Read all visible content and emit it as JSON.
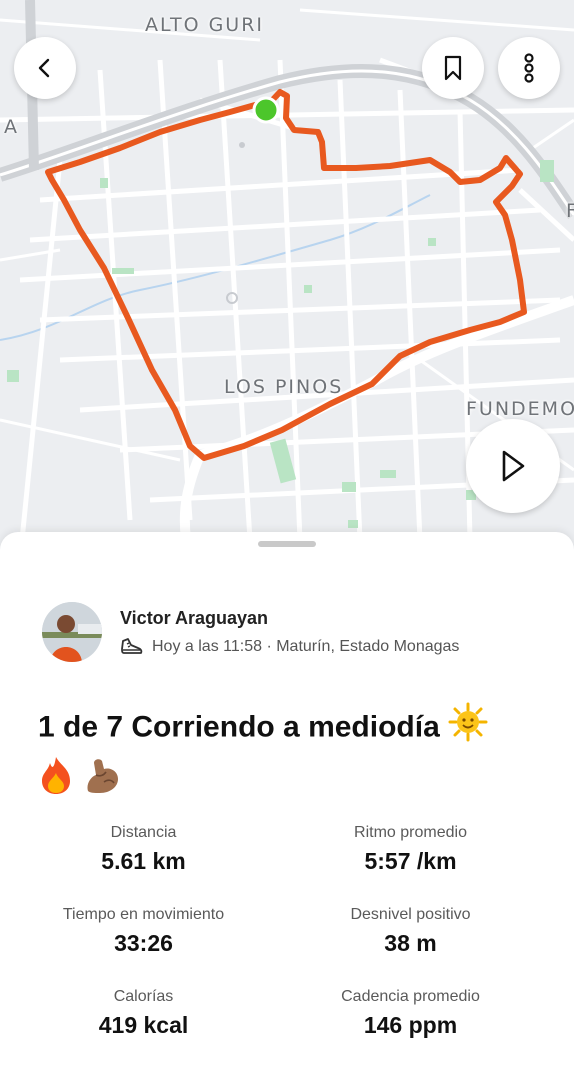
{
  "map": {
    "labels": {
      "alto_guri": "ALTO GURI",
      "los_pinos": "LOS PINOS",
      "fundemo": "FUNDEMO",
      "edge_left": "A",
      "edge_right": "F"
    },
    "colors": {
      "route": "#e8591f",
      "start_marker": "#4cc62b",
      "background": "#eceef1",
      "road": "#ffffff",
      "highway": "#cfd2d6",
      "park": "#b9e4c4",
      "water": "#b8d4ef"
    }
  },
  "toolbar": {
    "back_icon": "chevron-left-icon",
    "bookmark_icon": "bookmark-icon",
    "more_icon": "more-vertical-icon",
    "play_icon": "play-icon"
  },
  "athlete": {
    "name": "Victor Araguayan",
    "meta": "Hoy a las 11:58 · Maturín, Estado Monagas",
    "activity_icon": "running-shoe-icon"
  },
  "activity": {
    "title": "1 de 7 Corriendo a mediodía",
    "emojis": [
      "sun-emoji",
      "fire-emoji",
      "flexed-biceps-emoji"
    ]
  },
  "stats": [
    {
      "label": "Distancia",
      "value": "5.61 km"
    },
    {
      "label": "Ritmo promedio",
      "value": "5:57 /km"
    },
    {
      "label": "Tiempo en movimiento",
      "value": "33:26"
    },
    {
      "label": "Desnivel positivo",
      "value": "38 m"
    },
    {
      "label": "Calorías",
      "value": "419 kcal"
    },
    {
      "label": "Cadencia promedio",
      "value": "146 ppm"
    }
  ]
}
